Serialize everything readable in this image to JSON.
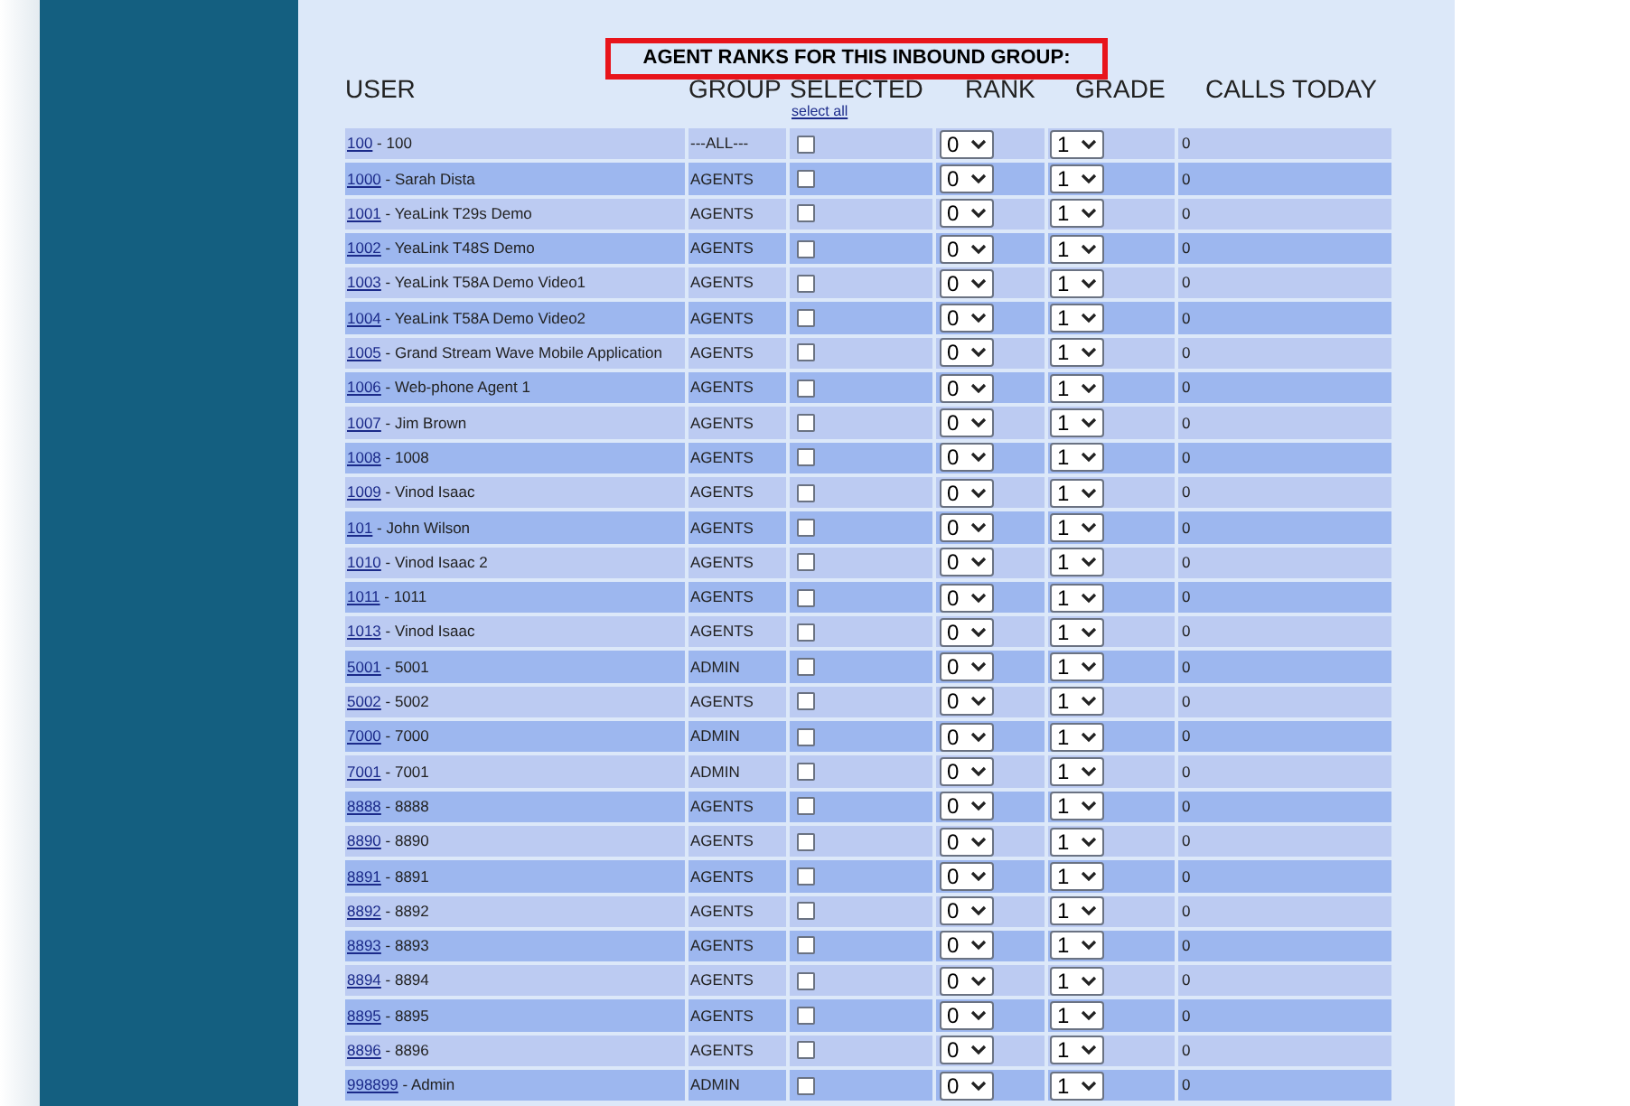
{
  "title": "AGENT RANKS FOR THIS INBOUND GROUP:",
  "columns": [
    "USER",
    "GROUP",
    "SELECTED",
    "RANK",
    "GRADE",
    "CALLS TODAY"
  ],
  "select_all": "select all",
  "rows": [
    {
      "id": "100",
      "name": " - 100",
      "group": "---ALL---",
      "selected": false,
      "rank": "0",
      "grade": "1",
      "calls": "0"
    },
    {
      "id": "1000",
      "name": " - Sarah Dista",
      "group": "AGENTS",
      "selected": false,
      "rank": "0",
      "grade": "1",
      "calls": "0"
    },
    {
      "id": "1001",
      "name": " - YeaLink T29s Demo",
      "group": "AGENTS",
      "selected": false,
      "rank": "0",
      "grade": "1",
      "calls": "0"
    },
    {
      "id": "1002",
      "name": " - YeaLink T48S Demo",
      "group": "AGENTS",
      "selected": false,
      "rank": "0",
      "grade": "1",
      "calls": "0"
    },
    {
      "id": "1003",
      "name": " - YeaLink T58A Demo Video1",
      "group": "AGENTS",
      "selected": false,
      "rank": "0",
      "grade": "1",
      "calls": "0"
    },
    {
      "id": "1004",
      "name": " - YeaLink T58A Demo Video2",
      "group": "AGENTS",
      "selected": false,
      "rank": "0",
      "grade": "1",
      "calls": "0"
    },
    {
      "id": "1005",
      "name": " - Grand Stream Wave Mobile Application",
      "group": "AGENTS",
      "selected": false,
      "rank": "0",
      "grade": "1",
      "calls": "0"
    },
    {
      "id": "1006",
      "name": " - Web-phone Agent 1",
      "group": "AGENTS",
      "selected": false,
      "rank": "0",
      "grade": "1",
      "calls": "0"
    },
    {
      "id": "1007",
      "name": " - Jim Brown",
      "group": "AGENTS",
      "selected": false,
      "rank": "0",
      "grade": "1",
      "calls": "0"
    },
    {
      "id": "1008",
      "name": " - 1008",
      "group": "AGENTS",
      "selected": false,
      "rank": "0",
      "grade": "1",
      "calls": "0"
    },
    {
      "id": "1009",
      "name": " - Vinod Isaac",
      "group": "AGENTS",
      "selected": false,
      "rank": "0",
      "grade": "1",
      "calls": "0"
    },
    {
      "id": "101",
      "name": " - John Wilson",
      "group": "AGENTS",
      "selected": false,
      "rank": "0",
      "grade": "1",
      "calls": "0"
    },
    {
      "id": "1010",
      "name": " - Vinod Isaac 2",
      "group": "AGENTS",
      "selected": false,
      "rank": "0",
      "grade": "1",
      "calls": "0"
    },
    {
      "id": "1011",
      "name": " - 1011",
      "group": "AGENTS",
      "selected": false,
      "rank": "0",
      "grade": "1",
      "calls": "0"
    },
    {
      "id": "1013",
      "name": " - Vinod Isaac",
      "group": "AGENTS",
      "selected": false,
      "rank": "0",
      "grade": "1",
      "calls": "0"
    },
    {
      "id": "5001",
      "name": " - 5001",
      "group": "ADMIN",
      "selected": false,
      "rank": "0",
      "grade": "1",
      "calls": "0"
    },
    {
      "id": "5002",
      "name": " - 5002",
      "group": "AGENTS",
      "selected": false,
      "rank": "0",
      "grade": "1",
      "calls": "0"
    },
    {
      "id": "7000",
      "name": " - 7000",
      "group": "ADMIN",
      "selected": false,
      "rank": "0",
      "grade": "1",
      "calls": "0"
    },
    {
      "id": "7001",
      "name": " - 7001",
      "group": "ADMIN",
      "selected": false,
      "rank": "0",
      "grade": "1",
      "calls": "0"
    },
    {
      "id": "8888",
      "name": " - 8888",
      "group": "AGENTS",
      "selected": false,
      "rank": "0",
      "grade": "1",
      "calls": "0"
    },
    {
      "id": "8890",
      "name": " - 8890",
      "group": "AGENTS",
      "selected": false,
      "rank": "0",
      "grade": "1",
      "calls": "0"
    },
    {
      "id": "8891",
      "name": " - 8891",
      "group": "AGENTS",
      "selected": false,
      "rank": "0",
      "grade": "1",
      "calls": "0"
    },
    {
      "id": "8892",
      "name": " - 8892",
      "group": "AGENTS",
      "selected": false,
      "rank": "0",
      "grade": "1",
      "calls": "0"
    },
    {
      "id": "8893",
      "name": " - 8893",
      "group": "AGENTS",
      "selected": false,
      "rank": "0",
      "grade": "1",
      "calls": "0"
    },
    {
      "id": "8894",
      "name": " - 8894",
      "group": "AGENTS",
      "selected": false,
      "rank": "0",
      "grade": "1",
      "calls": "0"
    },
    {
      "id": "8895",
      "name": " - 8895",
      "group": "AGENTS",
      "selected": false,
      "rank": "0",
      "grade": "1",
      "calls": "0"
    },
    {
      "id": "8896",
      "name": " - 8896",
      "group": "AGENTS",
      "selected": false,
      "rank": "0",
      "grade": "1",
      "calls": "0"
    },
    {
      "id": "998899",
      "name": " - Admin",
      "group": "ADMIN",
      "selected": false,
      "rank": "0",
      "grade": "1",
      "calls": "0"
    }
  ]
}
